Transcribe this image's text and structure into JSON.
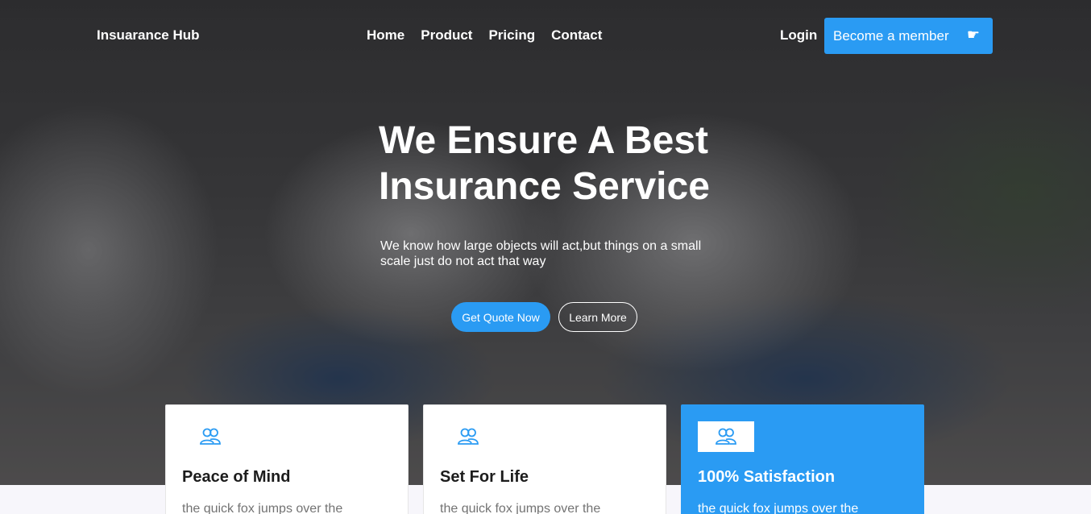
{
  "header": {
    "brand": "Insuarance Hub",
    "nav": [
      "Home",
      "Product",
      "Pricing",
      "Contact"
    ],
    "login": "Login",
    "member_button": "Become a member"
  },
  "hero": {
    "title_line1": "We Ensure A Best",
    "title_line2": "Insurance Service",
    "subtitle": "We know how large objects will act,but things on a small scale just do not act that way",
    "primary_button": "Get Quote Now",
    "secondary_button": "Learn More"
  },
  "features": [
    {
      "title": "Peace of Mind",
      "text": "the quick fox jumps over the",
      "icon": "users-icon",
      "active": false
    },
    {
      "title": "Set For Life",
      "text": "the quick fox jumps over the",
      "icon": "users-icon",
      "active": false
    },
    {
      "title": "100% Satisfaction",
      "text": "the quick fox jumps over the",
      "icon": "users-icon",
      "active": true
    }
  ],
  "colors": {
    "accent": "#2a9bf3",
    "card_bg": "#ffffff",
    "text_dark": "#1c1c1c",
    "text_muted": "#737373"
  }
}
